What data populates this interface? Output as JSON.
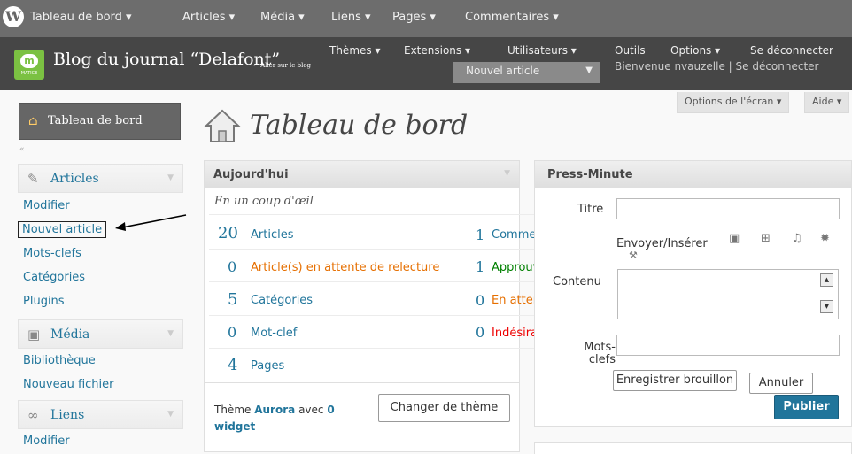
{
  "topbar": {
    "items": [
      "Tableau de bord ▾",
      "Articles ▾",
      "Média ▾",
      "Liens ▾",
      "Pages ▾",
      "Commentaires ▾"
    ]
  },
  "header": {
    "logo_text": "m",
    "logo_caption": "MATICE",
    "site_title": "Blog du journal “Delafont”",
    "site_link": "← Aller sur le blog",
    "nav": [
      "Thèmes ▾",
      "Extensions ▾",
      "Utilisateurs ▾",
      "Outils",
      "Options ▾",
      "Se déconnecter"
    ],
    "new_post": "Nouvel article",
    "welcome": "Bienvenue nvauzelle | Se déconnecter"
  },
  "screen": {
    "options": "Options de l'écran ▾",
    "help": "Aide ▾",
    "title": "Tableau de bord"
  },
  "sidebar": {
    "dashboard": "Tableau de bord",
    "collapse": "«",
    "articles": {
      "label": "Articles",
      "items": [
        "Modifier",
        "Nouvel article",
        "Mots-clefs",
        "Catégories",
        "Plugins"
      ]
    },
    "media": {
      "label": "Média",
      "items": [
        "Bibliothèque",
        "Nouveau fichier"
      ]
    },
    "links": {
      "label": "Liens",
      "items": [
        "Modifier"
      ]
    }
  },
  "today": {
    "title": "Aujourd'hui",
    "glance": "En un coup d'œil",
    "content_rows": [
      {
        "num": "20",
        "label": "Articles"
      },
      {
        "num": "0",
        "label": "Article(s) en attente de relecture"
      },
      {
        "num": "5",
        "label": "Catégories"
      },
      {
        "num": "0",
        "label": "Mot-clef"
      },
      {
        "num": "4",
        "label": "Pages"
      }
    ],
    "comment_rows": [
      {
        "num": "1",
        "label": "Commentaire"
      },
      {
        "num": "1",
        "label": "Approuvé"
      },
      {
        "num": "0",
        "label": "En attente"
      },
      {
        "num": "0",
        "label": "Indésirable"
      }
    ],
    "theme_prefix": "Thème",
    "theme_name": "Aurora",
    "theme_middle": "avec",
    "widget_count": "0",
    "widget_word": "widget",
    "change_theme": "Changer de thème"
  },
  "press": {
    "title": "Press-Minute",
    "title_label": "Titre",
    "upload_label": "Envoyer/Insérer",
    "content_label": "Contenu",
    "tags_label": "Mots-clefs",
    "save_draft": "Enregistrer brouillon",
    "cancel": "Annuler",
    "publish": "Publier"
  },
  "colors": {
    "link": "#21759b",
    "topbar": "#6d6d6d",
    "header": "#464646"
  }
}
